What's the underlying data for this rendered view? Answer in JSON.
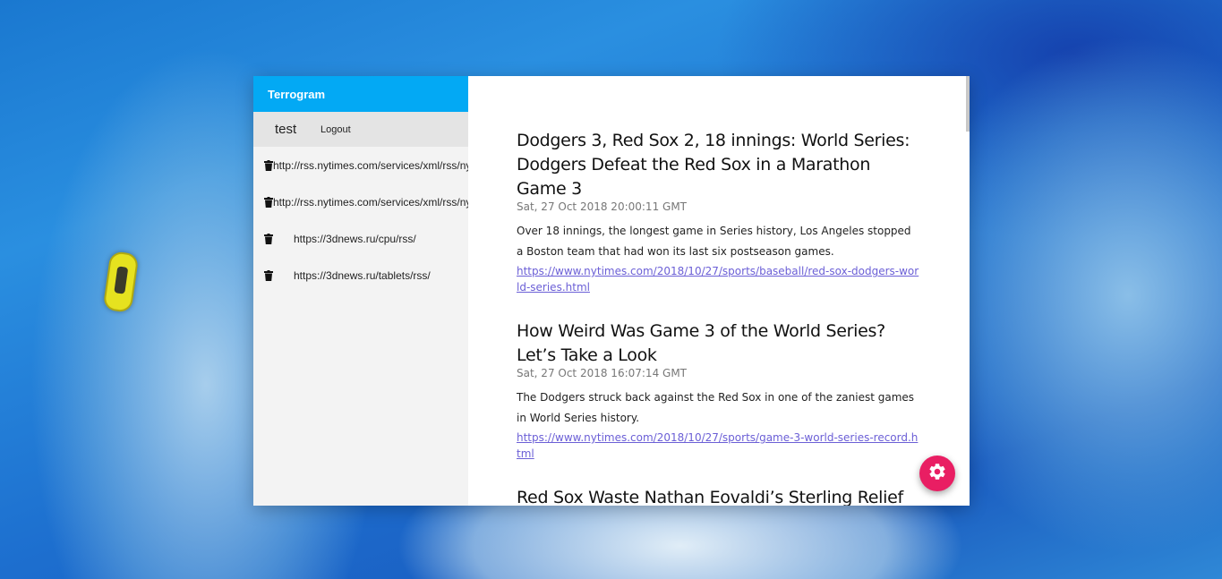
{
  "app": {
    "title": "Terrogram"
  },
  "user": {
    "name": "test",
    "logout_label": "Logout"
  },
  "feeds": [
    {
      "url": "http://rss.nytimes.com/services/xml/rss/nyt/Sports.xml",
      "icon": "trash-icon"
    },
    {
      "url": "http://rss.nytimes.com/services/xml/rss/nyt/Baseball.xml",
      "icon": "trash-icon"
    },
    {
      "url": "https://3dnews.ru/cpu/rss/",
      "icon": "trash-icon"
    },
    {
      "url": "https://3dnews.ru/tablets/rss/",
      "icon": "trash-icon"
    }
  ],
  "articles": [
    {
      "title": "Dodgers 3, Red Sox 2, 18 innings: World Series: Dodgers Defeat the Red Sox in a Marathon Game 3",
      "date": "Sat, 27 Oct 2018 20:00:11 GMT",
      "description": "Over 18 innings, the longest game in Series history, Los Angeles stopped a Boston team that had won its last six postseason games.",
      "link": "https://www.nytimes.com/2018/10/27/sports/baseball/red-sox-dodgers-world-series.html"
    },
    {
      "title": "How Weird Was Game 3 of the World Series? Let’s Take a Look",
      "date": "Sat, 27 Oct 2018 16:07:14 GMT",
      "description": "The Dodgers struck back against the Red Sox in one of the zaniest games in World Series history.",
      "link": "https://www.nytimes.com/2018/10/27/sports/game-3-world-series-record.html"
    },
    {
      "title": "Red Sox Waste Nathan Eovaldi’s Sterling Relief",
      "date": "",
      "description": "",
      "link": ""
    }
  ],
  "fab": {
    "icon": "gear-icon",
    "color": "#e91e63"
  },
  "colors": {
    "appbar": "#03a9f4",
    "link": "#6b5fd6"
  }
}
